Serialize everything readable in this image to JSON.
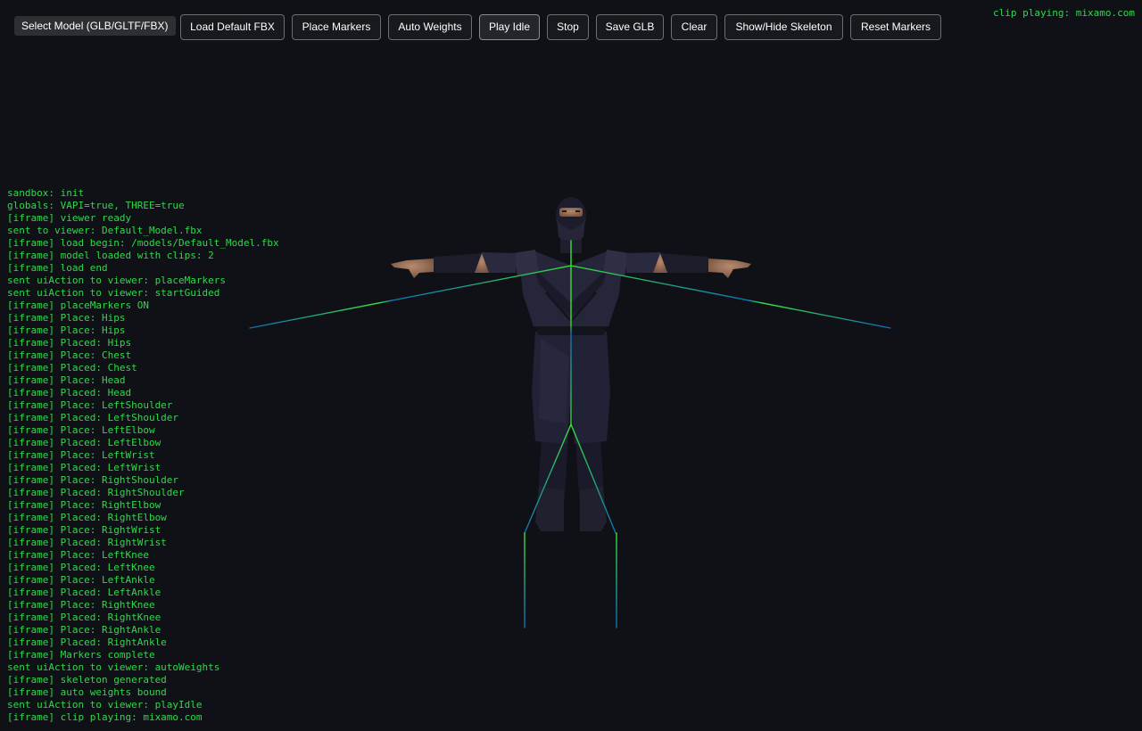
{
  "toolbar": {
    "select_model_label": "Select Model (GLB/GLTF/FBX)",
    "buttons": [
      {
        "label": "Load Default FBX"
      },
      {
        "label": "Place Markers"
      },
      {
        "label": "Auto Weights"
      },
      {
        "label": "Play Idle"
      },
      {
        "label": "Stop"
      },
      {
        "label": "Save GLB"
      },
      {
        "label": "Clear"
      },
      {
        "label": "Show/Hide Skeleton"
      },
      {
        "label": "Reset Markers"
      }
    ]
  },
  "status": {
    "clip_playing": "clip playing: mixamo.com"
  },
  "viewport": {
    "model_icon": "ninja-character-model",
    "skeleton_color": "#39e03a",
    "skeleton_tip_color": "#0f6fb5"
  },
  "log": {
    "lines": [
      "sandbox: init",
      "globals: VAPI=true, THREE=true",
      "[iframe] viewer ready",
      "sent to viewer: Default_Model.fbx",
      "[iframe] load begin: /models/Default_Model.fbx",
      "[iframe] model loaded with clips: 2",
      "[iframe] load end",
      "sent uiAction to viewer: placeMarkers",
      "sent uiAction to viewer: startGuided",
      "[iframe] placeMarkers ON",
      "[iframe] Place: Hips",
      "[iframe] Place: Hips",
      "[iframe] Placed: Hips",
      "[iframe] Place: Chest",
      "[iframe] Placed: Chest",
      "[iframe] Place: Head",
      "[iframe] Placed: Head",
      "[iframe] Place: LeftShoulder",
      "[iframe] Placed: LeftShoulder",
      "[iframe] Place: LeftElbow",
      "[iframe] Placed: LeftElbow",
      "[iframe] Place: LeftWrist",
      "[iframe] Placed: LeftWrist",
      "[iframe] Place: RightShoulder",
      "[iframe] Placed: RightShoulder",
      "[iframe] Place: RightElbow",
      "[iframe] Placed: RightElbow",
      "[iframe] Place: RightWrist",
      "[iframe] Placed: RightWrist",
      "[iframe] Place: LeftKnee",
      "[iframe] Placed: LeftKnee",
      "[iframe] Place: LeftAnkle",
      "[iframe] Placed: LeftAnkle",
      "[iframe] Place: RightKnee",
      "[iframe] Placed: RightKnee",
      "[iframe] Place: RightAnkle",
      "[iframe] Placed: RightAnkle",
      "[iframe] Markers complete",
      "sent uiAction to viewer: autoWeights",
      "[iframe] skeleton generated",
      "[iframe] auto weights bound",
      "sent uiAction to viewer: playIdle",
      "[iframe] clip playing: mixamo.com"
    ]
  }
}
